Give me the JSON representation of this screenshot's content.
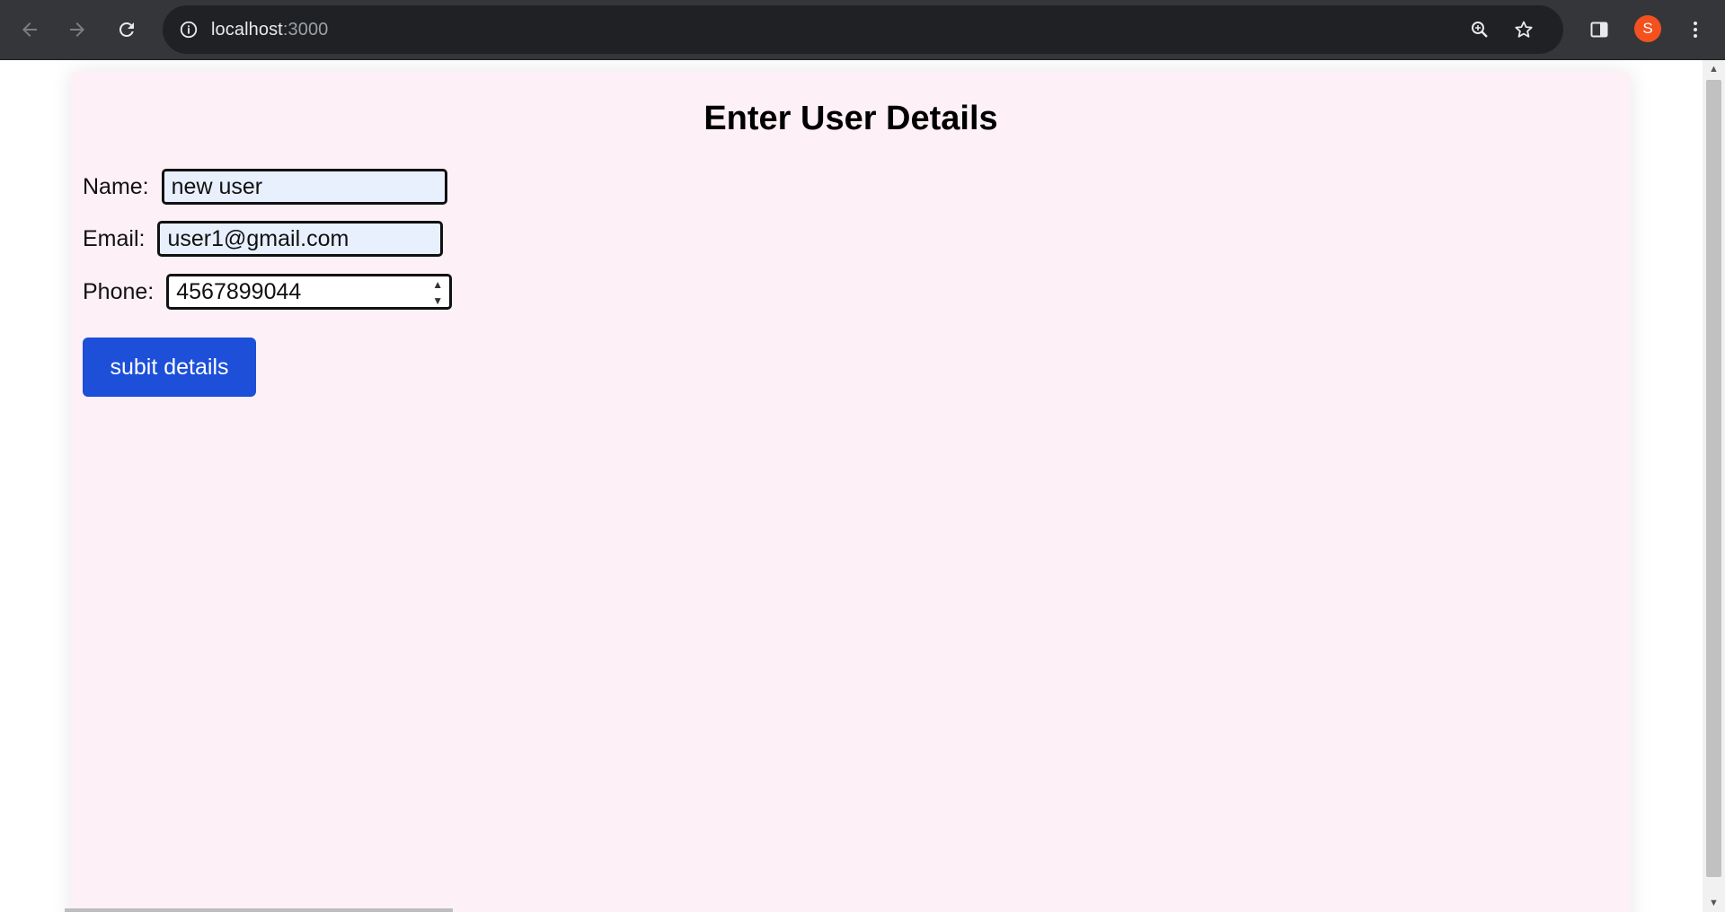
{
  "browser": {
    "url_host": "localhost",
    "url_port": ":3000",
    "profile_initial": "S",
    "icons": [
      "back-icon",
      "forward-icon",
      "reload-icon",
      "info-icon",
      "zoom-icon",
      "star-icon",
      "side-panel-icon",
      "more-icon"
    ]
  },
  "form": {
    "title": "Enter User Details",
    "name_label": "Name:",
    "name_value": "new user",
    "email_label": "Email:",
    "email_value": "user1@gmail.com",
    "phone_label": "Phone:",
    "phone_value": "4567899044",
    "submit_label": "subit details"
  },
  "colors": {
    "card_background": "#fdf0f6",
    "submit_button": "#1d4fd8",
    "autofill_field": "#e8f0fe",
    "browser_toolbar": "#35363a",
    "avatar": "#f4511e"
  }
}
